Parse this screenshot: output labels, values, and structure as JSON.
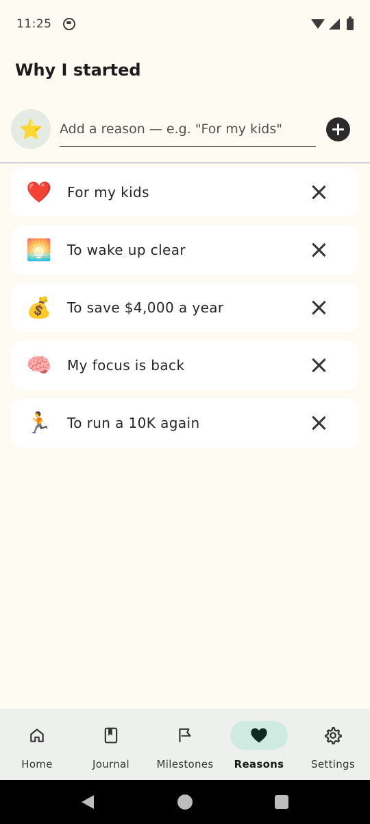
{
  "status_bar": {
    "time": "11:25"
  },
  "page": {
    "title": "Why I started"
  },
  "add_reason": {
    "selected_emoji": "⭐",
    "input_value": "",
    "placeholder": "Add a reason — e.g. \"For my kids\""
  },
  "reasons": [
    {
      "emoji": "❤️",
      "text": "For my kids"
    },
    {
      "emoji": "🌅",
      "text": "To wake up clear"
    },
    {
      "emoji": "💰",
      "text": "To save $4,000 a year"
    },
    {
      "emoji": "🧠",
      "text": "My focus is back"
    },
    {
      "emoji": "🏃",
      "text": "To run a 10K again"
    }
  ],
  "bottom_nav": {
    "items": [
      {
        "label": "Home",
        "icon": "home-icon"
      },
      {
        "label": "Journal",
        "icon": "journal-icon"
      },
      {
        "label": "Milestones",
        "icon": "flag-icon"
      },
      {
        "label": "Reasons",
        "icon": "heart-icon"
      },
      {
        "label": "Settings",
        "icon": "gear-icon"
      }
    ],
    "active_index": 3
  },
  "colors": {
    "background": "#fefbf3",
    "active_nav_pill": "#cfeae0",
    "nav_background": "#eef0ee"
  }
}
